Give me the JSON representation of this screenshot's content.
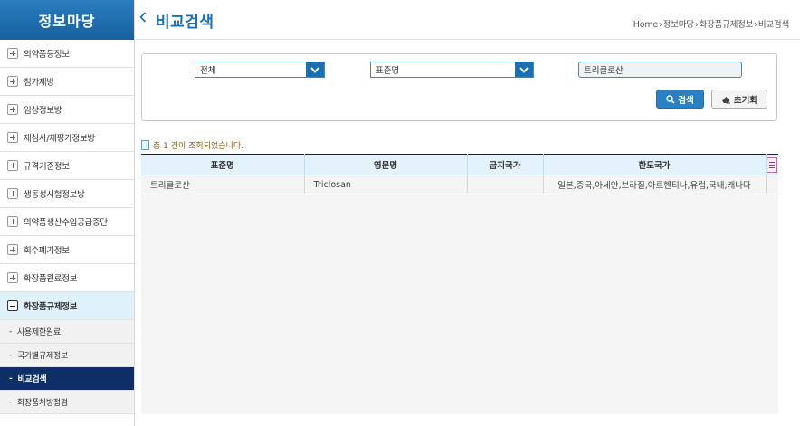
{
  "sidebar": {
    "title": "정보마당",
    "menu": [
      {
        "label": "의약품등정보",
        "expanded": false
      },
      {
        "label": "첨가제방",
        "expanded": false
      },
      {
        "label": "임상정보방",
        "expanded": false
      },
      {
        "label": "제심사/재평가정보방",
        "expanded": false
      },
      {
        "label": "규격기준정보",
        "expanded": false
      },
      {
        "label": "생동성시험정보방",
        "expanded": false
      },
      {
        "label": "의약품생산수입공급중단",
        "expanded": false
      },
      {
        "label": "회수폐기정보",
        "expanded": false
      },
      {
        "label": "화장품원료정보",
        "expanded": false
      },
      {
        "label": "화장품규제정보",
        "expanded": true
      }
    ],
    "submenu": [
      {
        "label": "사용제한원료",
        "selected": false
      },
      {
        "label": "국가별규제정보",
        "selected": false
      },
      {
        "label": "비교검색",
        "selected": true
      },
      {
        "label": "화장품처방점검",
        "selected": false
      }
    ]
  },
  "header": {
    "title": "비교검색",
    "breadcrumb": [
      "Home",
      "정보마당",
      "화장품규제정보",
      "비교검색"
    ]
  },
  "search": {
    "category_select": "전체",
    "field_select": "표준명",
    "keyword_value": "트리클로산",
    "search_label": "검색",
    "reset_label": "초기화"
  },
  "result": {
    "count_text": "총 1 건이 조회되었습니다."
  },
  "table": {
    "headers": [
      "표준명",
      "영문명",
      "금지국가",
      "한도국가"
    ],
    "rows": [
      [
        "트리클로산",
        "Triclosan",
        "",
        "일본,중국,아세안,브라질,아르헨티나,유럽,국내,캐나다"
      ]
    ]
  },
  "colors": {
    "primary": "#1d6fb0",
    "selected_nav": "#0d2f66",
    "active_menu_bg": "#dff1fb",
    "table_header_bg": "#e4f3fb"
  }
}
